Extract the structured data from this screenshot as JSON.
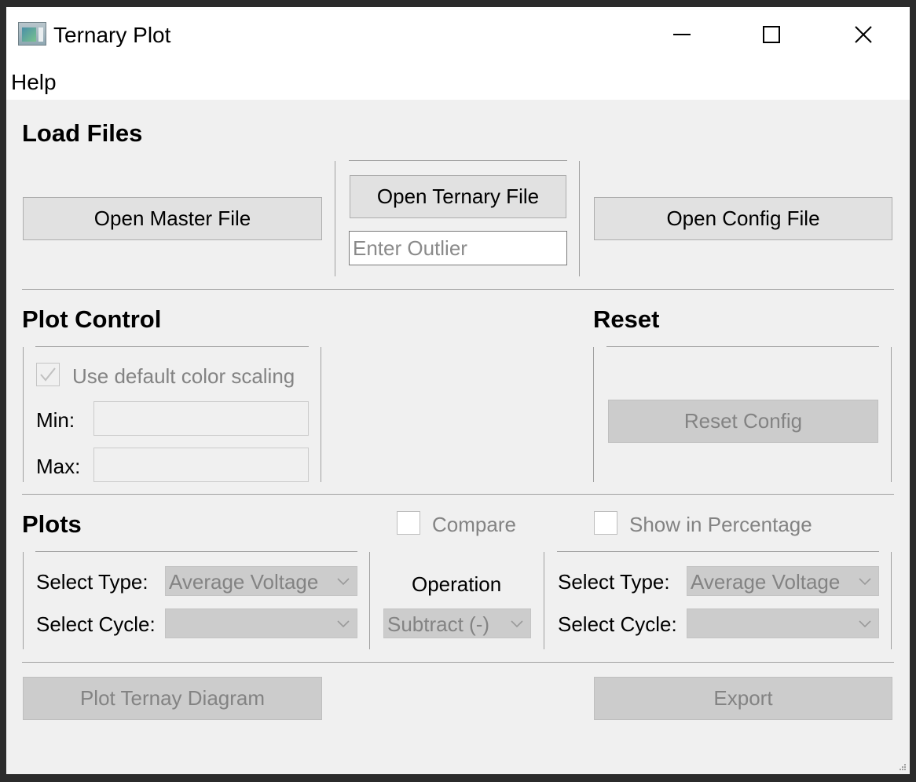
{
  "window": {
    "title": "Ternary Plot"
  },
  "menu": {
    "help": "Help"
  },
  "load_files": {
    "title": "Load Files",
    "open_master": "Open Master File",
    "open_ternary": "Open Ternary File",
    "outlier_placeholder": "Enter Outlier",
    "open_config": "Open Config File"
  },
  "plot_control": {
    "title": "Plot Control",
    "default_scaling_label": "Use default color scaling",
    "default_scaling_checked": true,
    "min_label": "Min:",
    "max_label": "Max:"
  },
  "reset": {
    "title": "Reset",
    "reset_config": "Reset Config"
  },
  "plots": {
    "title": "Plots",
    "compare_label": "Compare",
    "percentage_label": "Show in Percentage",
    "left": {
      "type_label": "Select Type:",
      "type_value": "Average Voltage",
      "cycle_label": "Select Cycle:",
      "cycle_value": ""
    },
    "operation_label": "Operation",
    "operation_value": "Subtract (-)",
    "right": {
      "type_label": "Select Type:",
      "type_value": "Average Voltage",
      "cycle_label": "Select Cycle:",
      "cycle_value": ""
    }
  },
  "actions": {
    "plot_button": "Plot Ternay Diagram",
    "export_button": "Export"
  }
}
